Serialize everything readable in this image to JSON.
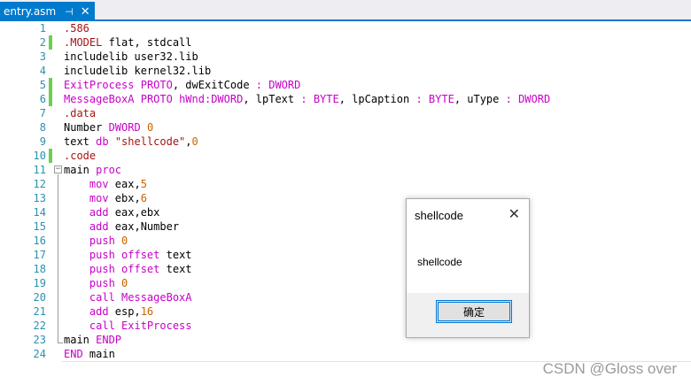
{
  "tab": {
    "title": "entry.asm",
    "pin_glyph": "⊣",
    "close_glyph": "✕"
  },
  "line_numbers": [
    "1",
    "2",
    "3",
    "4",
    "5",
    "6",
    "7",
    "8",
    "9",
    "10",
    "11",
    "12",
    "13",
    "14",
    "15",
    "16",
    "17",
    "18",
    "19",
    "20",
    "21",
    "22",
    "23",
    "24"
  ],
  "changed_lines": [
    2,
    5,
    6,
    10
  ],
  "fold_glyph": "−",
  "code": [
    [
      {
        "t": ".586",
        "c": "dir"
      }
    ],
    [
      {
        "t": ".MODEL",
        "c": "dir"
      },
      {
        "t": " flat, stdcall",
        "c": ""
      }
    ],
    [
      {
        "t": "includelib user32.lib",
        "c": ""
      }
    ],
    [
      {
        "t": "includelib kernel32.lib",
        "c": ""
      }
    ],
    [
      {
        "t": "ExitProcess",
        "c": "kw"
      },
      {
        "t": " ",
        "c": ""
      },
      {
        "t": "PROTO",
        "c": "kw"
      },
      {
        "t": ", dwExitCode ",
        "c": ""
      },
      {
        "t": ":",
        "c": "kw"
      },
      {
        "t": " ",
        "c": ""
      },
      {
        "t": "DWORD",
        "c": "dbl"
      }
    ],
    [
      {
        "t": "MessageBoxA",
        "c": "kw"
      },
      {
        "t": " ",
        "c": ""
      },
      {
        "t": "PROTO",
        "c": "kw"
      },
      {
        "t": " ",
        "c": ""
      },
      {
        "t": "hWnd:DWORD",
        "c": "kw"
      },
      {
        "t": ", lpText ",
        "c": ""
      },
      {
        "t": ":",
        "c": "kw"
      },
      {
        "t": " ",
        "c": ""
      },
      {
        "t": "BYTE",
        "c": "dbl"
      },
      {
        "t": ", lpCaption ",
        "c": ""
      },
      {
        "t": ":",
        "c": "kw"
      },
      {
        "t": " ",
        "c": ""
      },
      {
        "t": "BYTE",
        "c": "dbl"
      },
      {
        "t": ", uType ",
        "c": ""
      },
      {
        "t": ":",
        "c": "kw"
      },
      {
        "t": " ",
        "c": ""
      },
      {
        "t": "DWORD",
        "c": "dbl"
      }
    ],
    [
      {
        "t": ".data",
        "c": "dir"
      }
    ],
    [
      {
        "t": "Number ",
        "c": ""
      },
      {
        "t": "DWORD",
        "c": "dbl"
      },
      {
        "t": " ",
        "c": ""
      },
      {
        "t": "0",
        "c": "num"
      }
    ],
    [
      {
        "t": "text ",
        "c": ""
      },
      {
        "t": "db",
        "c": "kw"
      },
      {
        "t": " ",
        "c": ""
      },
      {
        "t": "\"shellcode\"",
        "c": "str"
      },
      {
        "t": ",",
        "c": ""
      },
      {
        "t": "0",
        "c": "num"
      }
    ],
    [
      {
        "t": ".code",
        "c": "dir"
      }
    ],
    [
      {
        "t": "main ",
        "c": ""
      },
      {
        "t": "proc",
        "c": "kw"
      }
    ],
    [
      {
        "t": "    mov ",
        "c": "kw"
      },
      {
        "t": "eax,",
        "c": ""
      },
      {
        "t": "5",
        "c": "num"
      }
    ],
    [
      {
        "t": "    mov ",
        "c": "kw"
      },
      {
        "t": "ebx,",
        "c": ""
      },
      {
        "t": "6",
        "c": "num"
      }
    ],
    [
      {
        "t": "    add ",
        "c": "kw"
      },
      {
        "t": "eax,ebx",
        "c": ""
      }
    ],
    [
      {
        "t": "    add ",
        "c": "kw"
      },
      {
        "t": "eax,Number",
        "c": ""
      }
    ],
    [
      {
        "t": "    push ",
        "c": "kw"
      },
      {
        "t": "0",
        "c": "num"
      }
    ],
    [
      {
        "t": "    push ",
        "c": "kw"
      },
      {
        "t": "offset",
        "c": "kw"
      },
      {
        "t": " text",
        "c": ""
      }
    ],
    [
      {
        "t": "    push ",
        "c": "kw"
      },
      {
        "t": "offset",
        "c": "kw"
      },
      {
        "t": " text",
        "c": ""
      }
    ],
    [
      {
        "t": "    push ",
        "c": "kw"
      },
      {
        "t": "0",
        "c": "num"
      }
    ],
    [
      {
        "t": "    call ",
        "c": "kw"
      },
      {
        "t": "MessageBoxA",
        "c": "kw"
      }
    ],
    [
      {
        "t": "    add ",
        "c": "kw"
      },
      {
        "t": "esp,",
        "c": ""
      },
      {
        "t": "16",
        "c": "num"
      }
    ],
    [
      {
        "t": "    call ",
        "c": "kw"
      },
      {
        "t": "ExitProcess",
        "c": "kw"
      }
    ],
    [
      {
        "t": "main ",
        "c": ""
      },
      {
        "t": "ENDP",
        "c": "kw"
      }
    ],
    [
      {
        "t": "END",
        "c": "kw"
      },
      {
        "t": " main",
        "c": ""
      }
    ]
  ],
  "dialog": {
    "title": "shellcode",
    "close_glyph": "✕",
    "message": "shellcode",
    "ok_label": "确定"
  },
  "watermark": "CSDN @Gloss over",
  "colors": {
    "tab_accent": "#007acc",
    "line_number": "#2b91af",
    "change_bar": "#6bd04a",
    "keyword": "#c800c8",
    "number": "#c86400",
    "string": "#a31515"
  }
}
